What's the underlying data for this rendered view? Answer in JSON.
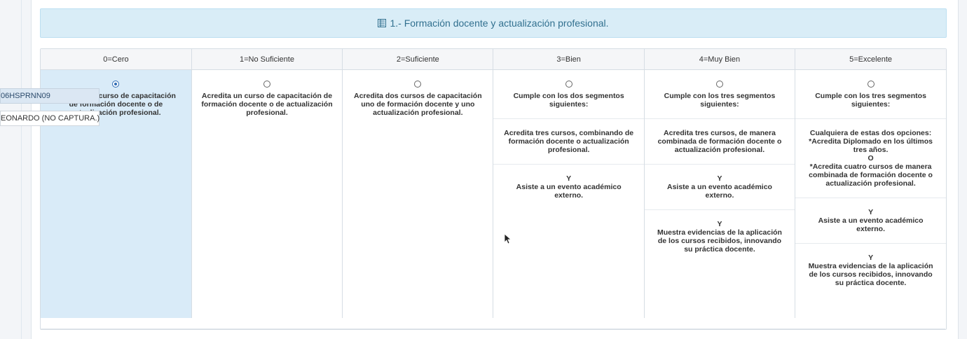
{
  "header": {
    "icon": "list-icon",
    "title": "1.- Formación docente y actualización profesional."
  },
  "colors": {
    "header_bg": "#d9edf7",
    "header_text": "#31708f",
    "selected_column_bg": "#d9ebf8",
    "radio_checked": "#2f6db5"
  },
  "columns": [
    {
      "label": "0=Cero",
      "selected": true,
      "segments": [
        [
          "Acredita un curso de capacitación",
          "de formación docente o de",
          "actualización profesional."
        ]
      ]
    },
    {
      "label": "1=No Suficiente",
      "selected": false,
      "segments": [
        [
          "Acredita un curso de capacitación de",
          "formación docente o de actualización",
          "profesional."
        ]
      ]
    },
    {
      "label": "2=Suficiente",
      "selected": false,
      "segments": [
        [
          "Acredita dos cursos de capacitación",
          "uno de formación docente y uno",
          "actualización profesional."
        ]
      ]
    },
    {
      "label": "3=Bien",
      "selected": false,
      "segments": [
        [
          "Cumple con los dos segmentos",
          "siguientes:"
        ],
        [
          "Acredita tres cursos, combinando de",
          "formación docente o actualización",
          "profesional."
        ],
        [
          "Y",
          "Asiste a un evento académico",
          "externo."
        ]
      ]
    },
    {
      "label": "4=Muy Bien",
      "selected": false,
      "segments": [
        [
          "Cumple con los tres segmentos",
          "siguientes:"
        ],
        [
          "Acredita tres cursos, de manera",
          "combinada de formación docente o",
          "actualización profesional."
        ],
        [
          "Y",
          "Asiste a un evento académico",
          "externo."
        ],
        [
          "Y",
          "Muestra evidencias de la aplicación",
          "de los cursos recibidos, innovando",
          "su práctica docente."
        ]
      ]
    },
    {
      "label": "5=Excelente",
      "selected": false,
      "segments": [
        [
          "Cumple con los tres segmentos",
          "siguientes:"
        ],
        [
          "Cualquiera de estas dos opciones:",
          "*Acredita Diplomado en los últimos",
          "tres años.",
          "O",
          "*Acredita cuatro cursos de manera",
          "combinada de formación docente o",
          "actualización profesional."
        ],
        [
          "Y",
          "Asiste a un evento académico",
          "externo."
        ],
        [
          "Y",
          "Muestra evidencias de la aplicación",
          "de los cursos recibidos, innovando",
          "su práctica docente."
        ]
      ]
    }
  ],
  "overlay": {
    "code": "06HSPRNN09",
    "name": "EONARDO (NO CAPTURA.)"
  }
}
